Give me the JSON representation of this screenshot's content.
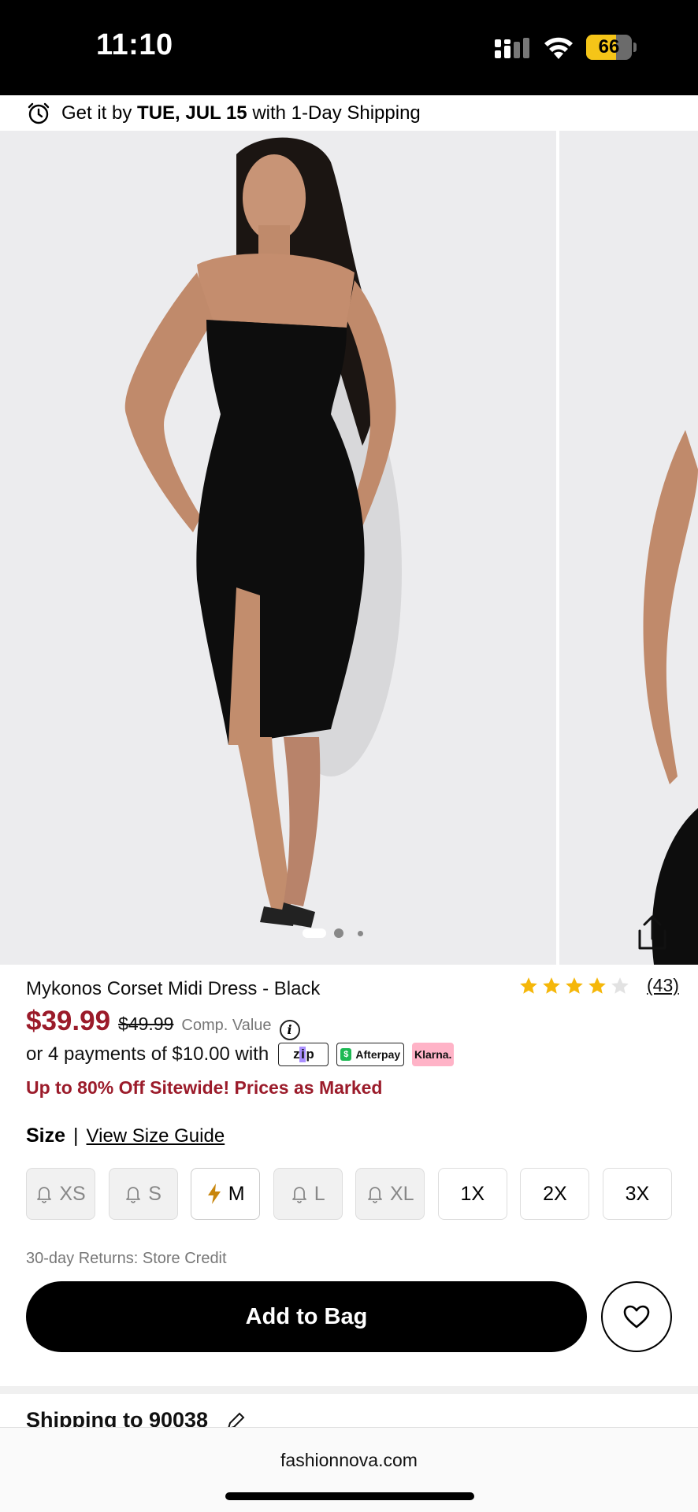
{
  "status_bar": {
    "time": "11:10",
    "battery_percent": 66,
    "battery_text": "66"
  },
  "shipping_banner": {
    "prefix": "Get it by",
    "date": "TUE, JUL 15",
    "suffix": "with 1-Day Shipping"
  },
  "gallery": {
    "slide_count": 3,
    "active_slide": 1
  },
  "product": {
    "title": "Mykonos Corset Midi Dress - Black",
    "rating": 4,
    "rating_max": 5,
    "review_count": "(43)",
    "price": "$39.99",
    "compare_price": "$49.99",
    "compare_label": "Comp. Value",
    "installments_text": "or 4 payments of $10.00 with",
    "pay_options": [
      "zip",
      "Afterpay",
      "Klarna."
    ],
    "promo": "Up to 80% Off Sitewide! Prices as Marked"
  },
  "size_section": {
    "label": "Size",
    "separator": "|",
    "guide_link": "View Size Guide",
    "sizes": [
      {
        "label": "XS",
        "state": "out_of_stock"
      },
      {
        "label": "S",
        "state": "out_of_stock"
      },
      {
        "label": "M",
        "state": "low_stock"
      },
      {
        "label": "L",
        "state": "out_of_stock"
      },
      {
        "label": "XL",
        "state": "out_of_stock"
      },
      {
        "label": "1X",
        "state": "available"
      },
      {
        "label": "2X",
        "state": "available"
      },
      {
        "label": "3X",
        "state": "available"
      }
    ]
  },
  "returns_text": "30-day Returns: Store Credit",
  "add_to_bag_label": "Add to Bag",
  "shipping_to": "Shipping to 90038",
  "browser": {
    "url": "fashionnova.com"
  },
  "colors": {
    "price_red": "#9b1b2a",
    "star_gold": "#f5b70a",
    "button_black": "#000000",
    "bolt_orange": "#c8860d"
  }
}
